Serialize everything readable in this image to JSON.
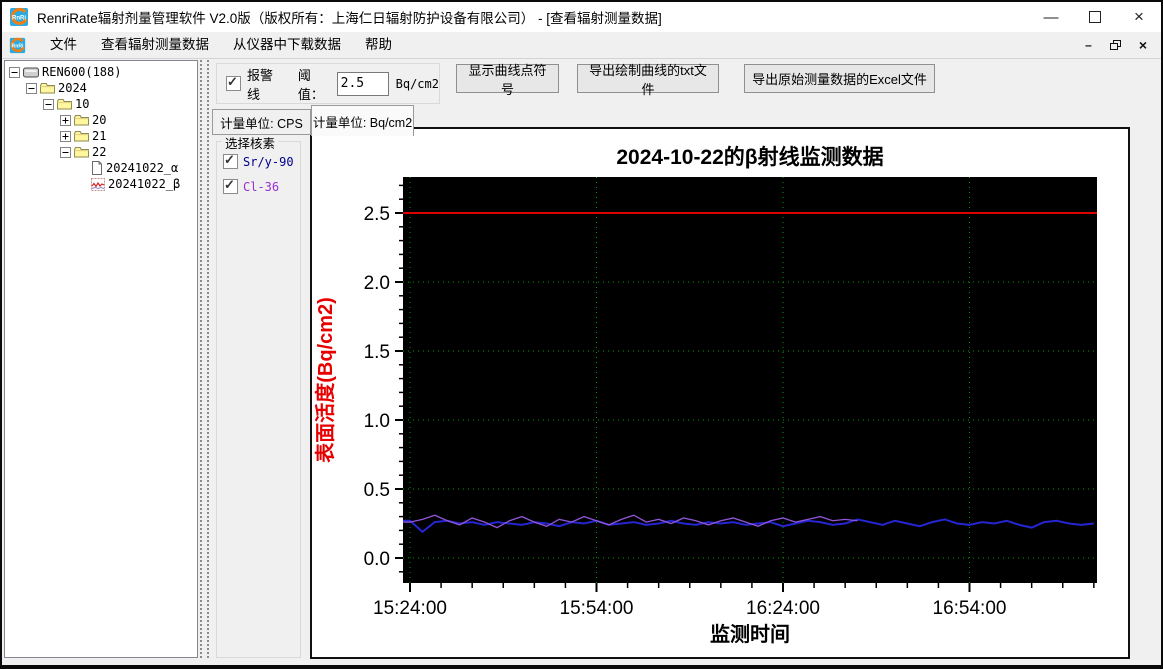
{
  "window": {
    "title": "RenriRate辐射剂量管理软件 V2.0版（版权所有：上海仁日辐射防护设备有限公司） - [查看辐射测量数据]",
    "logo_text": "RnRi"
  },
  "menu": {
    "items": [
      "文件",
      "查看辐射测量数据",
      "从仪器中下载数据",
      "帮助"
    ]
  },
  "tree": {
    "items": [
      {
        "label": "REN600(188)",
        "level": 0,
        "expander": "minus",
        "icon": "device"
      },
      {
        "label": "2024",
        "level": 1,
        "expander": "minus",
        "icon": "folder"
      },
      {
        "label": "10",
        "level": 2,
        "expander": "minus",
        "icon": "folder"
      },
      {
        "label": "20",
        "level": 3,
        "expander": "plus",
        "icon": "folder"
      },
      {
        "label": "21",
        "level": 3,
        "expander": "plus",
        "icon": "folder"
      },
      {
        "label": "22",
        "level": 3,
        "expander": "minus",
        "icon": "folder"
      },
      {
        "label": "20241022_α",
        "level": 4,
        "expander": "none",
        "icon": "document"
      },
      {
        "label": "20241022_β",
        "level": 4,
        "expander": "none",
        "icon": "chart"
      }
    ]
  },
  "toolbar": {
    "alarm_checkbox_label": "报警线",
    "alarm_checked": true,
    "threshold_label": "阈值：",
    "threshold_value": "2.5",
    "threshold_unit": "Bq/cm2",
    "buttons": [
      "显示曲线点符号",
      "导出绘制曲线的txt文件",
      "导出原始测量数据的Excel文件"
    ]
  },
  "tabs": [
    {
      "label": "计量单位: CPS",
      "active": false
    },
    {
      "label": "计量单位: Bq/cm2",
      "active": true
    }
  ],
  "nuclide_panel": {
    "title": "选择核素",
    "options": [
      {
        "label": "Sr/y-90",
        "checked": true,
        "color": "#00008c"
      },
      {
        "label": "Cl-36",
        "checked": true,
        "color": "#9b30d0"
      }
    ]
  },
  "chart_data": {
    "type": "line",
    "title": "2024-10-22的β射线监测数据",
    "xlabel": "监测时间",
    "ylabel": "表面活度(Bq/cm2)",
    "ylabel_color": "#e80000",
    "x_tick_labels": [
      "15:24:00",
      "15:54:00",
      "16:24:00",
      "16:54:00"
    ],
    "x_tick_minutes": [
      0,
      30,
      60,
      90
    ],
    "x_minor_step_minutes": 5,
    "x_max_minutes": 110,
    "y_ticks": [
      0.0,
      0.5,
      1.0,
      1.5,
      2.0,
      2.5
    ],
    "y_minor_step": 0.1,
    "ylim": [
      -0.18,
      2.76
    ],
    "grid": true,
    "legend_position": "none",
    "plot_bg_color": "#000000",
    "grid_color": "#00a000",
    "alarm_threshold": 2.5,
    "alarm_color": "#dd0000",
    "series": [
      {
        "name": "Sr/y-90",
        "color": "#2525d2",
        "width": 2,
        "step_minutes": 2,
        "values": [
          0.27,
          0.19,
          0.26,
          0.27,
          0.25,
          0.26,
          0.24,
          0.26,
          0.25,
          0.24,
          0.26,
          0.25,
          0.23,
          0.26,
          0.25,
          0.27,
          0.24,
          0.25,
          0.26,
          0.24,
          0.25,
          0.27,
          0.25,
          0.24,
          0.26,
          0.25,
          0.26,
          0.24,
          0.25,
          0.26,
          0.23,
          0.25,
          0.27,
          0.26,
          0.24,
          0.25,
          0.28,
          0.26,
          0.24,
          0.27,
          0.25,
          0.23,
          0.26,
          0.28,
          0.25,
          0.24,
          0.26,
          0.25,
          0.27,
          0.24,
          0.22,
          0.26,
          0.27,
          0.25,
          0.24,
          0.25
        ]
      },
      {
        "name": "Cl-36",
        "color": "#9055d8",
        "width": 1.3,
        "step_minutes": 2,
        "values": [
          0.26,
          0.28,
          0.31,
          0.27,
          0.24,
          0.29,
          0.26,
          0.22,
          0.27,
          0.3,
          0.26,
          0.23,
          0.28,
          0.26,
          0.3,
          0.27,
          0.24,
          0.28,
          0.31,
          0.26,
          0.28,
          0.25,
          0.29,
          0.27,
          0.24,
          0.27,
          0.29,
          0.26,
          0.23,
          0.27,
          0.29,
          0.26,
          0.28,
          0.3,
          0.27,
          0.28,
          0.27
        ]
      }
    ]
  }
}
